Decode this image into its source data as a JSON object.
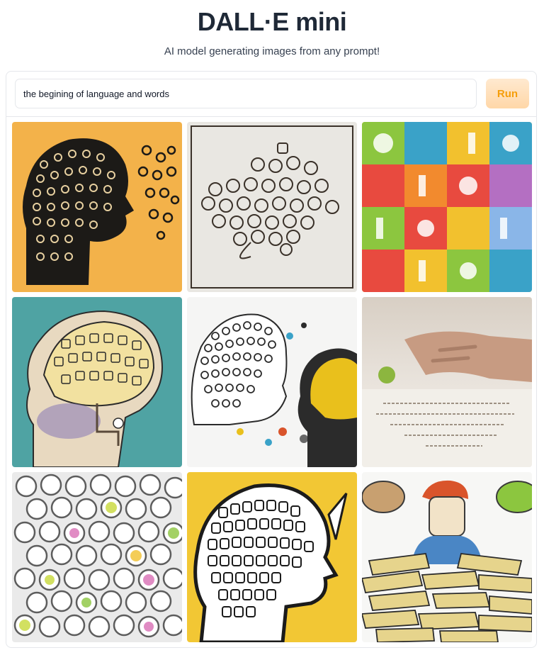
{
  "header": {
    "title": "DALL·E mini",
    "subtitle": "AI model generating images from any prompt!"
  },
  "prompt": {
    "value": "the begining of language and words"
  },
  "run_button": {
    "label": "Run"
  },
  "results": {
    "images": [
      {
        "name": "head-silhouette-letters",
        "colors": [
          "#f3b24a",
          "#1c1a17",
          "#e7d0a0"
        ]
      },
      {
        "name": "letter-cloud-sketch",
        "colors": [
          "#e9e7e2",
          "#3a3129",
          "#c9b9a4"
        ]
      },
      {
        "name": "colorful-letter-blocks",
        "colors": [
          "#3aa2c8",
          "#e84a3f",
          "#8cc63f",
          "#f2c12e"
        ]
      },
      {
        "name": "brain-head-teal",
        "colors": [
          "#4fa3a3",
          "#f2e1a0",
          "#8d7fb5"
        ]
      },
      {
        "name": "two-heads-letters",
        "colors": [
          "#f5f5f4",
          "#2b2b2b",
          "#e9c01c"
        ]
      },
      {
        "name": "hand-on-book",
        "colors": [
          "#e9e3dc",
          "#c79b82",
          "#7a6a58"
        ]
      },
      {
        "name": "colorful-letter-swirls",
        "colors": [
          "#eaeaea",
          "#5d5d5d",
          "#c8d93a",
          "#d96fb5"
        ]
      },
      {
        "name": "head-outline-letters-yellow",
        "colors": [
          "#f2c734",
          "#ffffff",
          "#1b1b1b"
        ]
      },
      {
        "name": "child-reading-books",
        "colors": [
          "#f7f7f5",
          "#d9542b",
          "#4a86c5",
          "#e6d48c"
        ]
      }
    ]
  }
}
